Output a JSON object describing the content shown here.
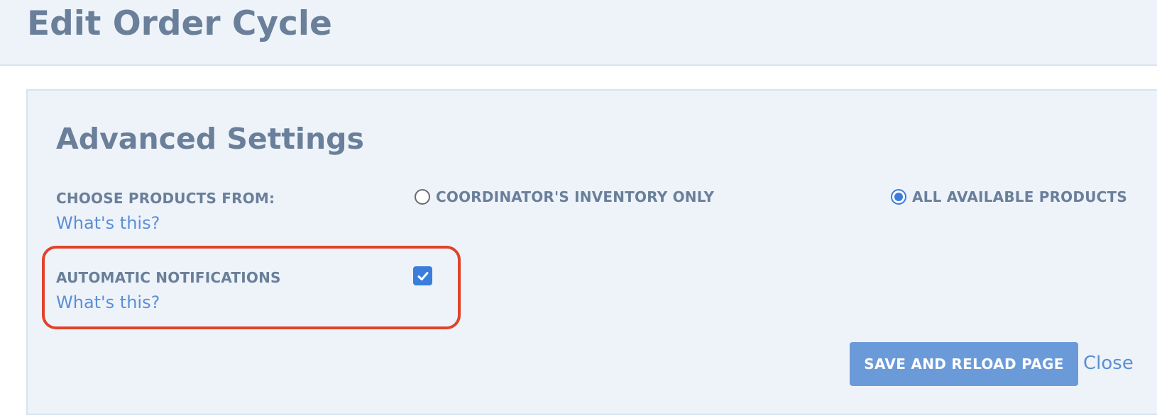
{
  "header": {
    "title": "Edit Order Cycle"
  },
  "panel": {
    "title": "Advanced Settings",
    "choose_products": {
      "label": "CHOOSE PRODUCTS FROM:",
      "help_link": "What's this?",
      "options": [
        {
          "label": "COORDINATOR'S INVENTORY ONLY",
          "selected": false
        },
        {
          "label": "ALL AVAILABLE PRODUCTS",
          "selected": true
        }
      ]
    },
    "automatic_notifications": {
      "label": "AUTOMATIC NOTIFICATIONS",
      "help_link": "What's this?",
      "checked": true
    },
    "actions": {
      "save_label": "SAVE AND RELOAD PAGE",
      "close_label": "Close"
    }
  },
  "colors": {
    "accent": "#3a7ddb",
    "button": "#6b9ad8",
    "link": "#5b8fd3",
    "text": "#6a7f99",
    "highlight": "#e0432b",
    "background": "#eef3fa"
  }
}
